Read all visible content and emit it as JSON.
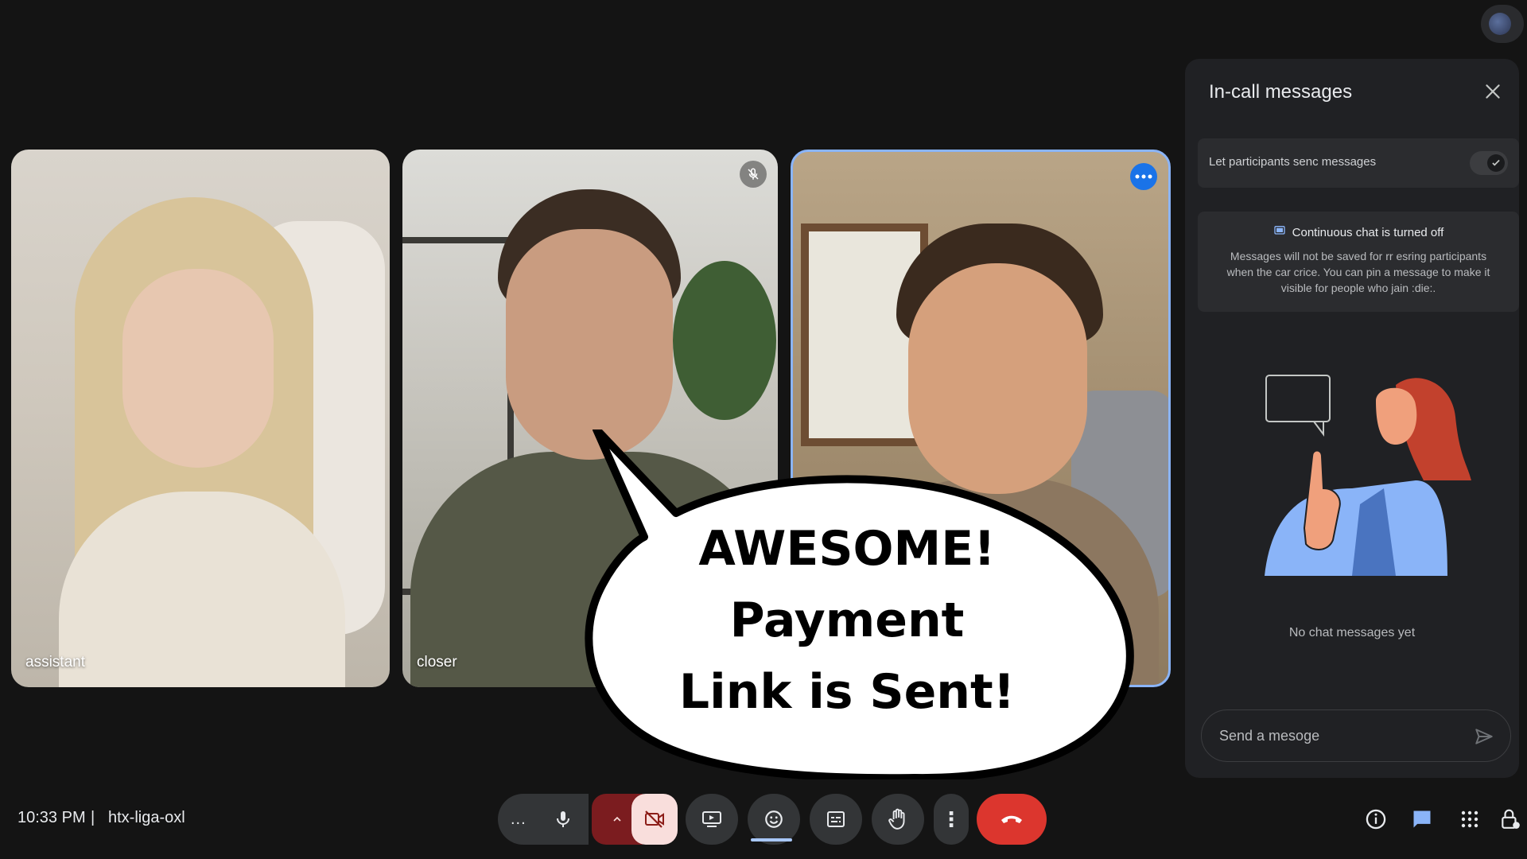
{
  "tiles": [
    {
      "name": "assistant",
      "muted": false,
      "more": false
    },
    {
      "name": "closer",
      "muted": true,
      "more": false
    },
    {
      "name": "",
      "muted": false,
      "more": true,
      "highlighted": true
    }
  ],
  "overlay": {
    "line1": "AWESOME!",
    "line2": "Payment",
    "line3": "Link is Sent!"
  },
  "panel": {
    "title": "In-call messages",
    "toggle_label": "Let participants senc messages",
    "toggle_on": true,
    "info_title": "Continuous chat is turned off",
    "info_body": "Messages will not be saved for rr esring participants when the car crice. You can pin a message to make it visible for people who jain :die:.",
    "empty_text": "No chat messages yet",
    "send_placeholder": "Send a mesoge"
  },
  "bottom_bar": {
    "time": "10:33 PM",
    "separator": "|",
    "meeting_code": "htx-liga-oxl",
    "more_options_label": "...",
    "more_label": "⋮"
  },
  "colors": {
    "background": "#141414",
    "panel": "#202124",
    "accent_blue": "#8ab4f8",
    "end_call_red": "#dc362e",
    "camera_off_red": "#7b1c1f",
    "camera_off_pink": "#f9dedc"
  },
  "icons": {
    "mic": "mic-icon",
    "camera_off": "videocam-off-icon",
    "present": "present-icon",
    "emoji": "emoji-icon",
    "captions": "captions-icon",
    "hand": "hand-raise-icon",
    "end_call": "call-end-icon",
    "info": "info-icon",
    "chat": "chat-icon",
    "activities": "apps-icon",
    "lock": "lock-icon"
  }
}
